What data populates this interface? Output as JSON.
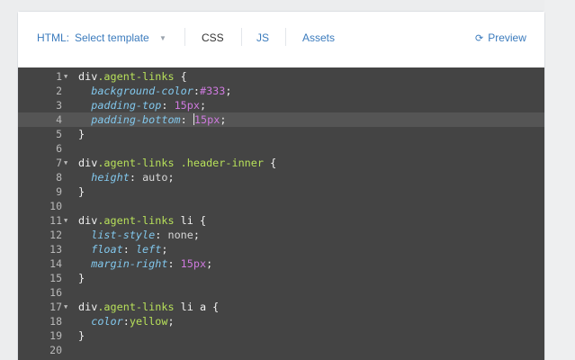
{
  "toolbar": {
    "html_label": "HTML:",
    "template_select": "Select template",
    "tabs": [
      {
        "label": "CSS",
        "active": true
      },
      {
        "label": "JS",
        "active": false
      },
      {
        "label": "Assets",
        "active": false
      }
    ],
    "preview_label": "Preview",
    "preview_icon": "refresh-icon",
    "caret_icon": "chevron-down-icon"
  },
  "colors": {
    "link": "#3b7bbd",
    "editor_bg": "#444444",
    "active_line": "#555555",
    "selector": "#b7e05a",
    "property": "#82c7ec",
    "number": "#cf7adf"
  },
  "editor": {
    "active_line": 4,
    "lines": [
      {
        "n": "1",
        "fold": true
      },
      {
        "n": "2"
      },
      {
        "n": "3"
      },
      {
        "n": "4"
      },
      {
        "n": "5"
      },
      {
        "n": "6"
      },
      {
        "n": "7",
        "fold": true
      },
      {
        "n": "8"
      },
      {
        "n": "9"
      },
      {
        "n": "10"
      },
      {
        "n": "11",
        "fold": true
      },
      {
        "n": "12"
      },
      {
        "n": "13"
      },
      {
        "n": "14"
      },
      {
        "n": "15"
      },
      {
        "n": "16"
      },
      {
        "n": "17",
        "fold": true
      },
      {
        "n": "18"
      },
      {
        "n": "19"
      },
      {
        "n": "20"
      }
    ],
    "tokens": {
      "l1_div": "div",
      "l1_cls": ".agent-links",
      "l1_tail": " {",
      "l2_prop": "background-color",
      "l2_colon": ":",
      "l2_val": "#333",
      "l2_semi": ";",
      "l3_prop": "padding-top",
      "l3_colon": ": ",
      "l3_num": "15",
      "l3_unit": "px",
      "l3_semi": ";",
      "l4_prop": "padding-bottom",
      "l4_colon": ": ",
      "l4_num": "15",
      "l4_unit": "px",
      "l4_semi": ";",
      "l5": "}",
      "l7_div": "div",
      "l7_cls": ".agent-links",
      "l7_mid": " ",
      "l7_cls2": ".header-inner",
      "l7_tail": " {",
      "l8_prop": "height",
      "l8_colon": ": ",
      "l8_val": "auto",
      "l8_semi": ";",
      "l9": "}",
      "l11_div": "div",
      "l11_cls": ".agent-links",
      "l11_tail": " li {",
      "l12_prop": "list-style",
      "l12_colon": ": ",
      "l12_val": "none",
      "l12_semi": ";",
      "l13_prop": "float",
      "l13_colon": ": ",
      "l13_val": "left",
      "l13_semi": ";",
      "l14_prop": "margin-right",
      "l14_colon": ": ",
      "l14_num": "15",
      "l14_unit": "px",
      "l14_semi": ";",
      "l15": "}",
      "l17_div": "div",
      "l17_cls": ".agent-links",
      "l17_tail": " li a {",
      "l18_prop": "color",
      "l18_colon": ":",
      "l18_val": "yellow",
      "l18_semi": ";",
      "l19": "}"
    }
  }
}
